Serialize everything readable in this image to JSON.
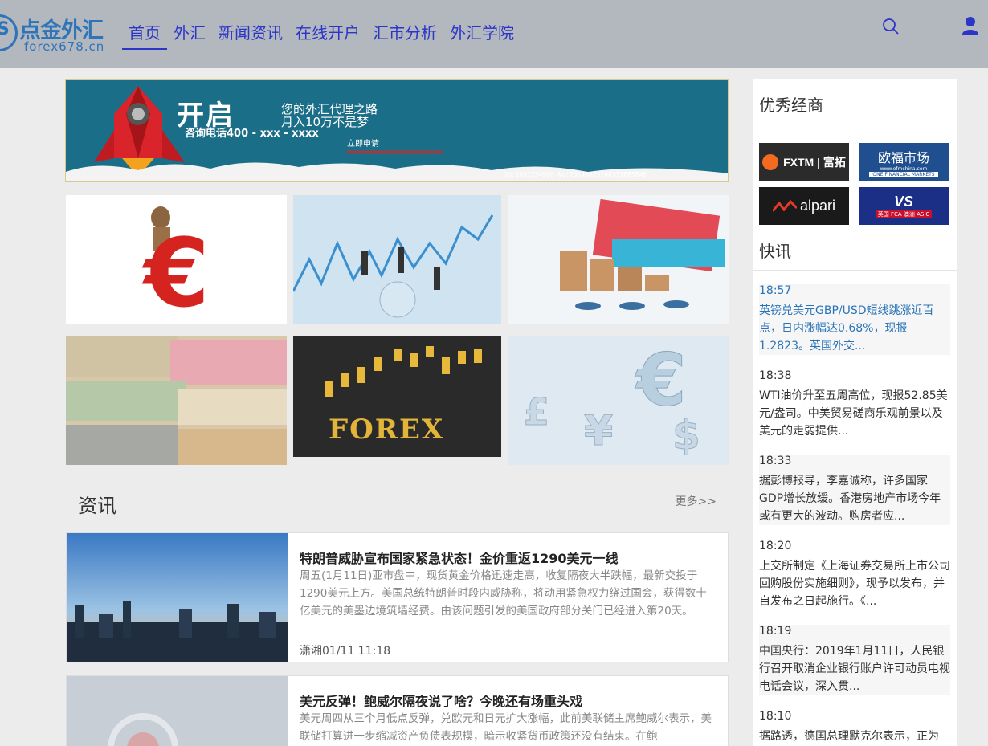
{
  "logo": {
    "mark": "S",
    "cn": "点金外汇",
    "en": "forex678.cn"
  },
  "nav": {
    "items": [
      "首页",
      "外汇",
      "新闻资讯",
      "在线开户",
      "汇市分析",
      "外汇学院"
    ]
  },
  "banner": {
    "title": "开启",
    "subtitle_line1": "您的外汇代理之路",
    "subtitle_line2": "月入10万不是梦",
    "phone": "咨询电话400 - xxx - xxxx",
    "cta": "立即申请",
    "footer": "QQ:1031234966 No:20140823160331665840"
  },
  "tiles": [
    {
      "name": "euro-figure"
    },
    {
      "name": "business-chart"
    },
    {
      "name": "coins-calculator"
    },
    {
      "name": "banknotes"
    },
    {
      "name": "forex-bull",
      "text": "FOREX"
    },
    {
      "name": "currency-symbols"
    }
  ],
  "news_section": {
    "title": "资讯",
    "more": "更多>>"
  },
  "news": [
    {
      "title": "特朗普威胁宣布国家紧急状态！金价重返1290美元一线",
      "summary": "周五(1月11日)亚市盘中，现货黄金价格迅速走高，收复隔夜大半跌幅，最新交投于1290美元上方。美国总统特朗普时段内威胁称，将动用紧急权力绕过国会，获得数十亿美元的美墨边境筑墙经费。由该问题引发的美国政府部分关门已经进入第20天。",
      "meta": "潇湘01/11 11:18"
    },
    {
      "title": "美元反弹！鲍威尔隔夜说了啥？今晚还有场重头戏",
      "summary": "美元周四从三个月低点反弹，兑欧元和日元扩大涨幅，此前美联储主席鲍威尔表示，美联储打算进一步缩减资产负债表规模，暗示收紧货币政策还没有结束。在鲍",
      "meta": ""
    }
  ],
  "sidebar": {
    "brokers_title": "优秀经商",
    "brokers": [
      {
        "label": "FXTM | 富拓",
        "color": "#2b2b2b"
      },
      {
        "label": "欧福市场",
        "sub": "www.ofmchina.com",
        "sub2": "ONE FINANCIAL MARKETS",
        "color": "#1f4f8e"
      },
      {
        "label": "alpari",
        "color": "#1a1a1a"
      },
      {
        "label": "VS",
        "sub": "英国 FCA   澳洲 ASIC",
        "color": "#1b2f86"
      }
    ],
    "flash_title": "快讯",
    "flash": [
      {
        "time": "18:57",
        "text": "英镑兑美元GBP/USD短线跳涨近百点，日内涨幅达0.68%，现报1.2823。英国外交...",
        "highlight": true
      },
      {
        "time": "18:38",
        "text": "WTI油价升至五周高位，现报52.85美元/盎司。中美贸易磋商乐观前景以及美元的走弱提供...",
        "highlight": false
      },
      {
        "time": "18:33",
        "text": "据彭博报导，李嘉诚称，许多国家GDP增长放缓。香港房地产市场今年或有更大的波动。购房者应...",
        "highlight": true
      },
      {
        "time": "18:20",
        "text": "上交所制定《上海证券交易所上市公司回购股份实施细则》，现予以发布，并自发布之日起施行。《...",
        "highlight": false
      },
      {
        "time": "18:19",
        "text": "中国央行：2019年1月11日，人民银行召开取消企业银行账户许可动员电视电话会议，深入贯...",
        "highlight": true
      },
      {
        "time": "18:10",
        "text": "据路透，德国总理默克尔表示，正为",
        "highlight": false
      }
    ]
  }
}
